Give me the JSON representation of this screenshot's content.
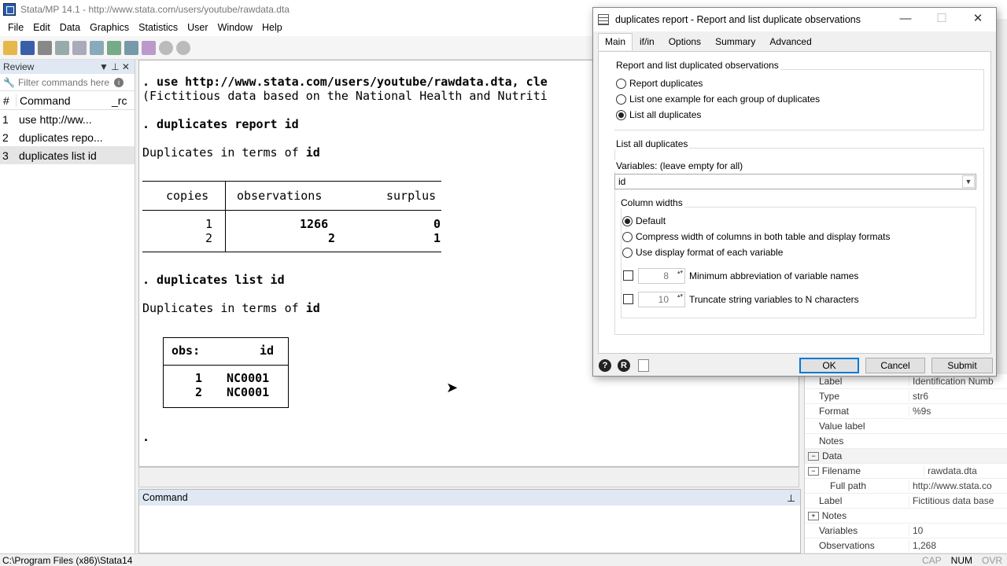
{
  "window": {
    "title": "Stata/MP 14.1 - http://www.stata.com/users/youtube/rawdata.dta"
  },
  "menu": [
    "File",
    "Edit",
    "Data",
    "Graphics",
    "Statistics",
    "User",
    "Window",
    "Help"
  ],
  "review": {
    "header": "Review",
    "filter_placeholder": "Filter commands here",
    "col_num": "#",
    "col_command": "Command",
    "col_rc": "_rc",
    "items": [
      {
        "n": "1",
        "text": "use http://ww..."
      },
      {
        "n": "2",
        "text": "duplicates repo..."
      },
      {
        "n": "3",
        "text": "duplicates list id"
      }
    ]
  },
  "results": {
    "line1": ". use http://www.stata.com/users/youtube/rawdata.dta, cle",
    "line2": "(Fictitious data based on the National Health and Nutriti",
    "cmd1": ". duplicates report id",
    "dup_title1": "Duplicates in terms of ",
    "dup_var": "id",
    "table1": {
      "h_copies": "copies",
      "h_obs": "observations",
      "h_surplus": "surplus",
      "rows": [
        {
          "copies": "1",
          "obs": "1266",
          "surplus": "0"
        },
        {
          "copies": "2",
          "obs": "2",
          "surplus": "1"
        }
      ]
    },
    "cmd2": ". duplicates list id",
    "dup_title2": "Duplicates in terms of ",
    "table2": {
      "h_obs": "obs:",
      "h_id": "id",
      "rows": [
        {
          "obs": "1",
          "id": "NC0001"
        },
        {
          "obs": "2",
          "id": "NC0001"
        }
      ]
    },
    "prompt": "."
  },
  "command_pane": {
    "header": "Command"
  },
  "properties": {
    "rows": [
      {
        "k": "Label",
        "v": "Identification Numb",
        "sec": false
      },
      {
        "k": "Type",
        "v": "str6",
        "sec": false
      },
      {
        "k": "Format",
        "v": "%9s",
        "sec": false
      },
      {
        "k": "Value label",
        "v": "",
        "sec": false
      },
      {
        "k": "Notes",
        "v": "",
        "sec": false
      },
      {
        "k": "Data",
        "v": "",
        "sec": true,
        "exp": "⊟"
      },
      {
        "k": "Filename",
        "v": "rawdata.dta",
        "sec": false,
        "exp": "⊟"
      },
      {
        "k": "Full path",
        "v": "http://www.stata.co",
        "sec": false,
        "indent": true
      },
      {
        "k": "Label",
        "v": "Fictitious data basec",
        "sec": false
      },
      {
        "k": "Notes",
        "v": "",
        "sec": false,
        "exp": "⊞"
      },
      {
        "k": "Variables",
        "v": "10",
        "sec": false
      },
      {
        "k": "Observations",
        "v": "1,268",
        "sec": false
      }
    ]
  },
  "status": {
    "path": "C:\\Program Files (x86)\\Stata14",
    "cap": "CAP",
    "num": "NUM",
    "ovr": "OVR"
  },
  "dialog": {
    "title": "duplicates report - Report and list duplicate observations",
    "tabs": [
      "Main",
      "if/in",
      "Options",
      "Summary",
      "Advanced"
    ],
    "group1_label": "Report and list duplicated observations",
    "radio_report": "Report duplicates",
    "radio_one": "List one example for each group of duplicates",
    "radio_all": "List all duplicates",
    "group2_label": "List all duplicates",
    "vars_label": "Variables: (leave empty for all)",
    "vars_value": "id",
    "colwidth_label": "Column widths",
    "radio_default": "Default",
    "radio_compress": "Compress width of columns in both table and display formats",
    "radio_display": "Use display format of each variable",
    "abbrev_value": "8",
    "abbrev_label": "Minimum abbreviation of variable names",
    "trunc_value": "10",
    "trunc_label": "Truncate string variables to N characters",
    "ok": "OK",
    "cancel": "Cancel",
    "submit": "Submit"
  },
  "colors": {
    "accent": "#0078d7",
    "pane_header": "#dfe8f3"
  }
}
